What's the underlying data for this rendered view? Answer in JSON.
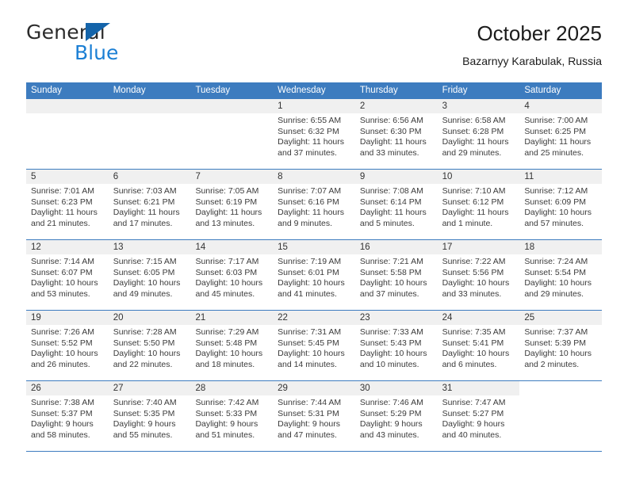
{
  "brand": {
    "name_top": "General",
    "name_bottom": "Blue",
    "accent_color": "#1b7fd4",
    "triangle_color": "#1464aa"
  },
  "header": {
    "title": "October 2025",
    "subtitle": "Bazarnyy Karabulak, Russia"
  },
  "theme": {
    "header_row_bg": "#3d7cbf",
    "day_number_bg": "#f0f0f0",
    "grid_line": "#3d7cbf",
    "text": "#3b3b3b"
  },
  "weekdays": [
    "Sunday",
    "Monday",
    "Tuesday",
    "Wednesday",
    "Thursday",
    "Friday",
    "Saturday"
  ],
  "weeks": [
    [
      {
        "day": "",
        "blank": false,
        "sunrise": "",
        "sunset": "",
        "daylight_1": "",
        "daylight_2": ""
      },
      {
        "day": "",
        "blank": false,
        "sunrise": "",
        "sunset": "",
        "daylight_1": "",
        "daylight_2": ""
      },
      {
        "day": "",
        "blank": false,
        "sunrise": "",
        "sunset": "",
        "daylight_1": "",
        "daylight_2": ""
      },
      {
        "day": "1",
        "blank": false,
        "sunrise": "Sunrise: 6:55 AM",
        "sunset": "Sunset: 6:32 PM",
        "daylight_1": "Daylight: 11 hours",
        "daylight_2": "and 37 minutes."
      },
      {
        "day": "2",
        "blank": false,
        "sunrise": "Sunrise: 6:56 AM",
        "sunset": "Sunset: 6:30 PM",
        "daylight_1": "Daylight: 11 hours",
        "daylight_2": "and 33 minutes."
      },
      {
        "day": "3",
        "blank": false,
        "sunrise": "Sunrise: 6:58 AM",
        "sunset": "Sunset: 6:28 PM",
        "daylight_1": "Daylight: 11 hours",
        "daylight_2": "and 29 minutes."
      },
      {
        "day": "4",
        "blank": false,
        "sunrise": "Sunrise: 7:00 AM",
        "sunset": "Sunset: 6:25 PM",
        "daylight_1": "Daylight: 11 hours",
        "daylight_2": "and 25 minutes."
      }
    ],
    [
      {
        "day": "5",
        "blank": false,
        "sunrise": "Sunrise: 7:01 AM",
        "sunset": "Sunset: 6:23 PM",
        "daylight_1": "Daylight: 11 hours",
        "daylight_2": "and 21 minutes."
      },
      {
        "day": "6",
        "blank": false,
        "sunrise": "Sunrise: 7:03 AM",
        "sunset": "Sunset: 6:21 PM",
        "daylight_1": "Daylight: 11 hours",
        "daylight_2": "and 17 minutes."
      },
      {
        "day": "7",
        "blank": false,
        "sunrise": "Sunrise: 7:05 AM",
        "sunset": "Sunset: 6:19 PM",
        "daylight_1": "Daylight: 11 hours",
        "daylight_2": "and 13 minutes."
      },
      {
        "day": "8",
        "blank": false,
        "sunrise": "Sunrise: 7:07 AM",
        "sunset": "Sunset: 6:16 PM",
        "daylight_1": "Daylight: 11 hours",
        "daylight_2": "and 9 minutes."
      },
      {
        "day": "9",
        "blank": false,
        "sunrise": "Sunrise: 7:08 AM",
        "sunset": "Sunset: 6:14 PM",
        "daylight_1": "Daylight: 11 hours",
        "daylight_2": "and 5 minutes."
      },
      {
        "day": "10",
        "blank": false,
        "sunrise": "Sunrise: 7:10 AM",
        "sunset": "Sunset: 6:12 PM",
        "daylight_1": "Daylight: 11 hours",
        "daylight_2": "and 1 minute."
      },
      {
        "day": "11",
        "blank": false,
        "sunrise": "Sunrise: 7:12 AM",
        "sunset": "Sunset: 6:09 PM",
        "daylight_1": "Daylight: 10 hours",
        "daylight_2": "and 57 minutes."
      }
    ],
    [
      {
        "day": "12",
        "blank": false,
        "sunrise": "Sunrise: 7:14 AM",
        "sunset": "Sunset: 6:07 PM",
        "daylight_1": "Daylight: 10 hours",
        "daylight_2": "and 53 minutes."
      },
      {
        "day": "13",
        "blank": false,
        "sunrise": "Sunrise: 7:15 AM",
        "sunset": "Sunset: 6:05 PM",
        "daylight_1": "Daylight: 10 hours",
        "daylight_2": "and 49 minutes."
      },
      {
        "day": "14",
        "blank": false,
        "sunrise": "Sunrise: 7:17 AM",
        "sunset": "Sunset: 6:03 PM",
        "daylight_1": "Daylight: 10 hours",
        "daylight_2": "and 45 minutes."
      },
      {
        "day": "15",
        "blank": false,
        "sunrise": "Sunrise: 7:19 AM",
        "sunset": "Sunset: 6:01 PM",
        "daylight_1": "Daylight: 10 hours",
        "daylight_2": "and 41 minutes."
      },
      {
        "day": "16",
        "blank": false,
        "sunrise": "Sunrise: 7:21 AM",
        "sunset": "Sunset: 5:58 PM",
        "daylight_1": "Daylight: 10 hours",
        "daylight_2": "and 37 minutes."
      },
      {
        "day": "17",
        "blank": false,
        "sunrise": "Sunrise: 7:22 AM",
        "sunset": "Sunset: 5:56 PM",
        "daylight_1": "Daylight: 10 hours",
        "daylight_2": "and 33 minutes."
      },
      {
        "day": "18",
        "blank": false,
        "sunrise": "Sunrise: 7:24 AM",
        "sunset": "Sunset: 5:54 PM",
        "daylight_1": "Daylight: 10 hours",
        "daylight_2": "and 29 minutes."
      }
    ],
    [
      {
        "day": "19",
        "blank": false,
        "sunrise": "Sunrise: 7:26 AM",
        "sunset": "Sunset: 5:52 PM",
        "daylight_1": "Daylight: 10 hours",
        "daylight_2": "and 26 minutes."
      },
      {
        "day": "20",
        "blank": false,
        "sunrise": "Sunrise: 7:28 AM",
        "sunset": "Sunset: 5:50 PM",
        "daylight_1": "Daylight: 10 hours",
        "daylight_2": "and 22 minutes."
      },
      {
        "day": "21",
        "blank": false,
        "sunrise": "Sunrise: 7:29 AM",
        "sunset": "Sunset: 5:48 PM",
        "daylight_1": "Daylight: 10 hours",
        "daylight_2": "and 18 minutes."
      },
      {
        "day": "22",
        "blank": false,
        "sunrise": "Sunrise: 7:31 AM",
        "sunset": "Sunset: 5:45 PM",
        "daylight_1": "Daylight: 10 hours",
        "daylight_2": "and 14 minutes."
      },
      {
        "day": "23",
        "blank": false,
        "sunrise": "Sunrise: 7:33 AM",
        "sunset": "Sunset: 5:43 PM",
        "daylight_1": "Daylight: 10 hours",
        "daylight_2": "and 10 minutes."
      },
      {
        "day": "24",
        "blank": false,
        "sunrise": "Sunrise: 7:35 AM",
        "sunset": "Sunset: 5:41 PM",
        "daylight_1": "Daylight: 10 hours",
        "daylight_2": "and 6 minutes."
      },
      {
        "day": "25",
        "blank": false,
        "sunrise": "Sunrise: 7:37 AM",
        "sunset": "Sunset: 5:39 PM",
        "daylight_1": "Daylight: 10 hours",
        "daylight_2": "and 2 minutes."
      }
    ],
    [
      {
        "day": "26",
        "blank": false,
        "sunrise": "Sunrise: 7:38 AM",
        "sunset": "Sunset: 5:37 PM",
        "daylight_1": "Daylight: 9 hours",
        "daylight_2": "and 58 minutes."
      },
      {
        "day": "27",
        "blank": false,
        "sunrise": "Sunrise: 7:40 AM",
        "sunset": "Sunset: 5:35 PM",
        "daylight_1": "Daylight: 9 hours",
        "daylight_2": "and 55 minutes."
      },
      {
        "day": "28",
        "blank": false,
        "sunrise": "Sunrise: 7:42 AM",
        "sunset": "Sunset: 5:33 PM",
        "daylight_1": "Daylight: 9 hours",
        "daylight_2": "and 51 minutes."
      },
      {
        "day": "29",
        "blank": false,
        "sunrise": "Sunrise: 7:44 AM",
        "sunset": "Sunset: 5:31 PM",
        "daylight_1": "Daylight: 9 hours",
        "daylight_2": "and 47 minutes."
      },
      {
        "day": "30",
        "blank": false,
        "sunrise": "Sunrise: 7:46 AM",
        "sunset": "Sunset: 5:29 PM",
        "daylight_1": "Daylight: 9 hours",
        "daylight_2": "and 43 minutes."
      },
      {
        "day": "31",
        "blank": false,
        "sunrise": "Sunrise: 7:47 AM",
        "sunset": "Sunset: 5:27 PM",
        "daylight_1": "Daylight: 9 hours",
        "daylight_2": "and 40 minutes."
      },
      {
        "day": "",
        "blank": true,
        "sunrise": "",
        "sunset": "",
        "daylight_1": "",
        "daylight_2": ""
      }
    ]
  ]
}
